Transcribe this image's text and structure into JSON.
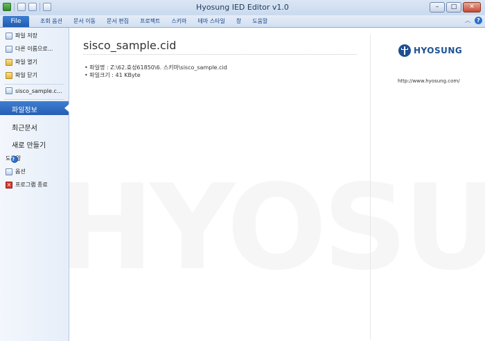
{
  "window": {
    "title": "Hyosung IED Editor v1.0",
    "minimize": "–",
    "maximize": "□",
    "close": "✕"
  },
  "menubar": {
    "file_tab": "File",
    "items": [
      "조회 옵션",
      "문서 이동",
      "문서 편집",
      "프로젝트",
      "스키마",
      "테마 스타일",
      "창",
      "도움말"
    ]
  },
  "sidebar": {
    "actions": [
      "파일 저장",
      "다른 이름으로...",
      "파일 열기",
      "파일 닫기"
    ],
    "recent_file": "sisco_sample.c...",
    "selected": "파일정보",
    "sections": [
      "최근문서",
      "새로 만들기"
    ],
    "bottom": [
      "도움말",
      "옵션",
      "프로그램 종료"
    ]
  },
  "main": {
    "file_title": "sisco_sample.cid",
    "file_path": "• 파일명 : Z:\\62.효성61850\\6. 스키마\\sisco_sample.cid",
    "file_size": "• 파일크기 : 41 KByte",
    "watermark": "HYOSUNG"
  },
  "brand": {
    "name": "HYOSUNG",
    "url": "http://www.hyosung.com/"
  },
  "colors": {
    "accent": "#245fb6",
    "brand": "#1d4f91"
  }
}
